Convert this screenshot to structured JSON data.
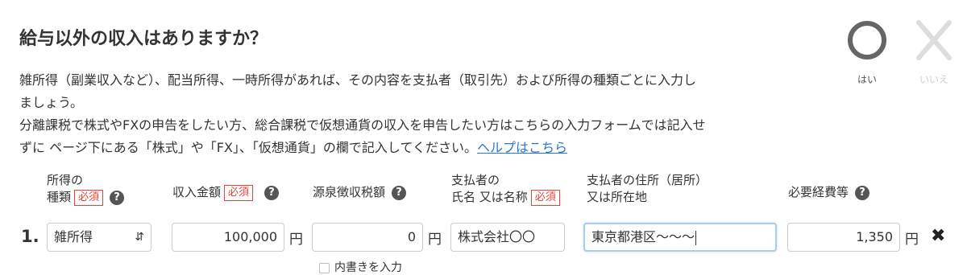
{
  "question": {
    "title": "給与以外の収入はありますか？"
  },
  "choices": {
    "yes_label": "はい",
    "no_label": "いいえ"
  },
  "description": {
    "line1": "雑所得（副業収入など）、配当所得、一時所得があれば、その内容を支払者（取引先）および所得の種類ごとに入力し",
    "line2": "ましょう。",
    "line3": "分離課税で株式やFXの申告をしたい方、総合課税で仮想通貨の収入を申告したい方はこちらの入力フォームでは記入せ",
    "line4": "ずに ページ下にある「株式」や「FX」、「仮想通貨」の欄で記入してください。",
    "help_link": "ヘルプはこちら"
  },
  "headers": {
    "income_type_line1": "所得の",
    "income_type_line2": "種類",
    "amount": "収入金額",
    "withholding": "源泉徴収税額",
    "payer_line1": "支払者の",
    "payer_line2": "氏名 又は名称",
    "address_line1": "支払者の住所（居所）",
    "address_line2": "又は所在地",
    "expenses": "必要経費等",
    "required": "必須",
    "help_glyph": "?"
  },
  "row": {
    "number": "1.",
    "income_type": "雑所得",
    "amount": "100,000",
    "withholding": "0",
    "payer": "株式会社〇〇",
    "address": "東京都港区〜〜〜",
    "expenses": "1,350",
    "unit": "円"
  },
  "breakdown_label": "内書きを入力",
  "icons": {
    "yes": "circle-icon",
    "no": "cross-icon",
    "help": "question-circle-icon",
    "delete": "close-icon",
    "select": "select-arrows-icon",
    "checkbox": "checkbox-icon"
  },
  "colors": {
    "required": "#e0453a",
    "link": "#2b78c5",
    "focus_border": "#a9cdf0",
    "yes_mark": "#666666",
    "no_mark": "#dddddd"
  }
}
